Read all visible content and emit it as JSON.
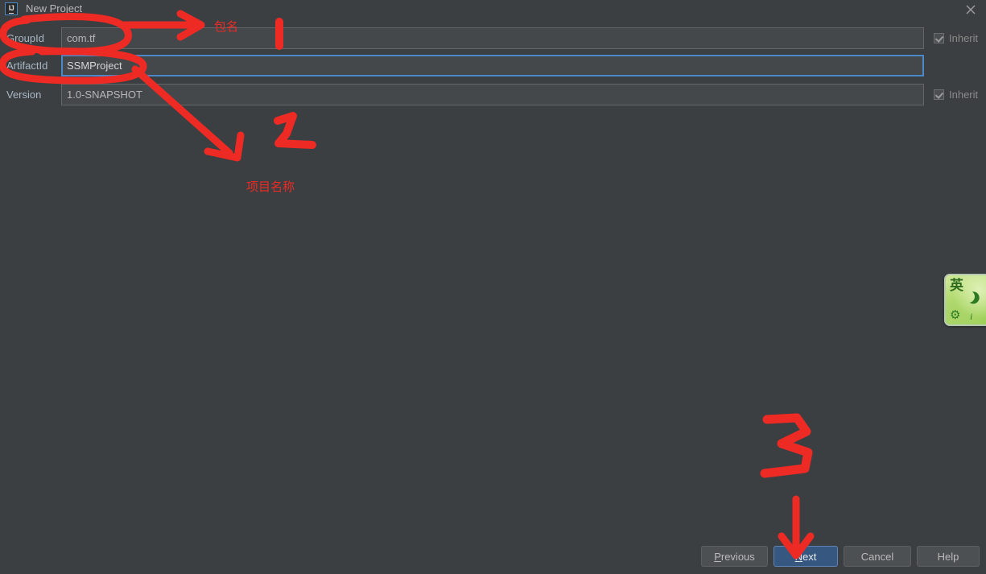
{
  "window": {
    "title": "New Project",
    "app_icon": "intellij-idea-icon",
    "icon_text": "IJ",
    "close_icon": "close-icon"
  },
  "form": {
    "rows": [
      {
        "label": "GroupId",
        "value": "com.tf",
        "focused": false,
        "inherit": true,
        "inherit_label": "Inherit"
      },
      {
        "label": "ArtifactId",
        "value": "SSMProject",
        "focused": true,
        "inherit": false,
        "inherit_label": ""
      },
      {
        "label": "Version",
        "value": "1.0-SNAPSHOT",
        "focused": false,
        "inherit": true,
        "inherit_label": "Inherit"
      }
    ]
  },
  "buttons": {
    "previous": {
      "label": "Previous",
      "mnemonic": "P",
      "default": false
    },
    "next": {
      "label": "Next",
      "mnemonic": "N",
      "default": true
    },
    "cancel": {
      "label": "Cancel",
      "mnemonic": "",
      "default": false
    },
    "help": {
      "label": "Help",
      "mnemonic": "",
      "default": false
    }
  },
  "ime": {
    "mode": "英",
    "moon_icon": "crescent-moon-icon",
    "gear_icon": "gear-icon",
    "info_icon": "i-icon"
  },
  "annotations": {
    "color": "#ee2a24",
    "package_name_label": "包名",
    "project_name_label": "项目名称",
    "marker_one": "1",
    "marker_two": "2",
    "marker_three": "3"
  }
}
